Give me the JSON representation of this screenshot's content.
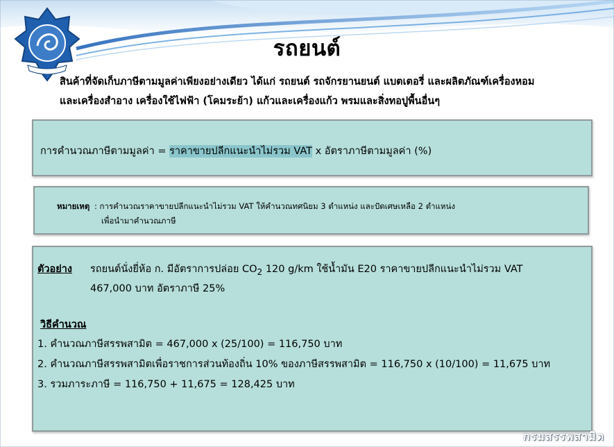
{
  "slide": {
    "title": "รถยนต์",
    "intro_line1": "สินค้าที่จัดเก็บภาษีตามมูลค่าเพียงอย่างเดียว ได้แก่ รถยนต์ รถจักรยานยนต์ แบตเตอรี่ และผลิตภัณฑ์เครื่องหอม",
    "intro_line2": "และเครื่องสำอาง เครื่องใช้ไฟฟ้า (โคมระย้า) แก้วและเครื่องแก้ว พรมและสิ่งทอปูพื้นอื่นๆ",
    "logo_text": "สรรพสามิต"
  },
  "formula": {
    "prefix": "การคำนวณภาษีตามมูลค่า = ",
    "highlight": "ราคาขายปลีกแนะนำไม่รวม VAT",
    "suffix": " x อัตราภาษีตามมูลค่า (%)"
  },
  "note": {
    "label": "หมายเหตุ",
    "line1": ": การคำนวณราคาขายปลีกแนะนำไม่รวม VAT ให้คำนวณทศนิยม 3 ตำแหน่ง และปัดเศษเหลือ 2 ตำแหน่ง",
    "line2": "เพื่อนำมาคำนวณภาษี"
  },
  "example": {
    "label": "ตัวอย่าง",
    "line1_a": "รถยนต์นั่งยี่ห้อ ก. มีอัตราการปล่อย CO",
    "line1_sub": "2",
    "line1_b": " 120 g/km ใช้น้ำมัน E20  ราคาขายปลีกแนะนำไม่รวม VAT",
    "line2": "467,000 บาท  อัตราภาษี 25%",
    "method_label": "วิธีคำนวณ",
    "step1": "1. คำนวณภาษีสรรพสามิต = 467,000 x (25/100)   = 116,750  บาท",
    "step2": "2. คำนวณภาษีสรรพสามิตเพื่อราชการส่วนท้องถิ่น 10% ของภาษีสรรพสามิต = 116,750 x (10/100) = 11,675 บาท",
    "step3": "3. รวมภาระภาษี = 116,750 + 11,675 = 128,425 บาท"
  },
  "footer": {
    "brand": "กรมสรรพสามิต"
  },
  "colors": {
    "box_fill": "#b6dfdb",
    "box_border": "#8f9a9b",
    "highlight": "#8ac6cc",
    "wave_blue": "#2f7fd0"
  }
}
